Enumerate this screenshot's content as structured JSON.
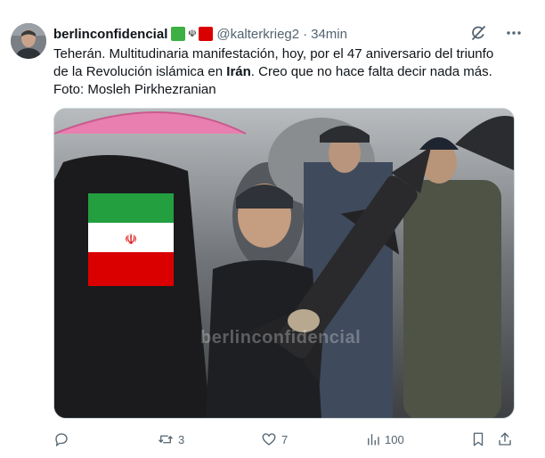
{
  "author": {
    "display_name": "berlinconfidencial",
    "handle": "@kalterkrieg2",
    "separator": "·",
    "time": "34min",
    "badges": [
      {
        "type": "square",
        "color": "#3cb043"
      },
      {
        "type": "emblem",
        "glyph": "☫"
      },
      {
        "type": "square",
        "color": "#da0000"
      }
    ]
  },
  "tweet": {
    "line1": "Teherán. Multitudinaria manifestación, hoy, por el 47 aniversario del triunfo",
    "line2_before": "de la Revolución islámica en ",
    "line2_bold": "Irán",
    "line2_after": ". Creo que no hace falta decir nada más.",
    "line3": "Foto: Mosleh Pirkhezranian"
  },
  "media": {
    "watermark": "berlinconfidencial"
  },
  "actions": {
    "reply_count": "",
    "retweet_count": "3",
    "like_count": "7",
    "views_count": "100"
  },
  "icons": {
    "grok": "grok-icon",
    "more": "more-icon",
    "reply": "reply-icon",
    "retweet": "retweet-icon",
    "like": "like-icon",
    "views": "views-icon",
    "bookmark": "bookmark-icon",
    "share": "share-icon"
  },
  "colors": {
    "text": "#0f1419",
    "secondary": "#536471"
  }
}
